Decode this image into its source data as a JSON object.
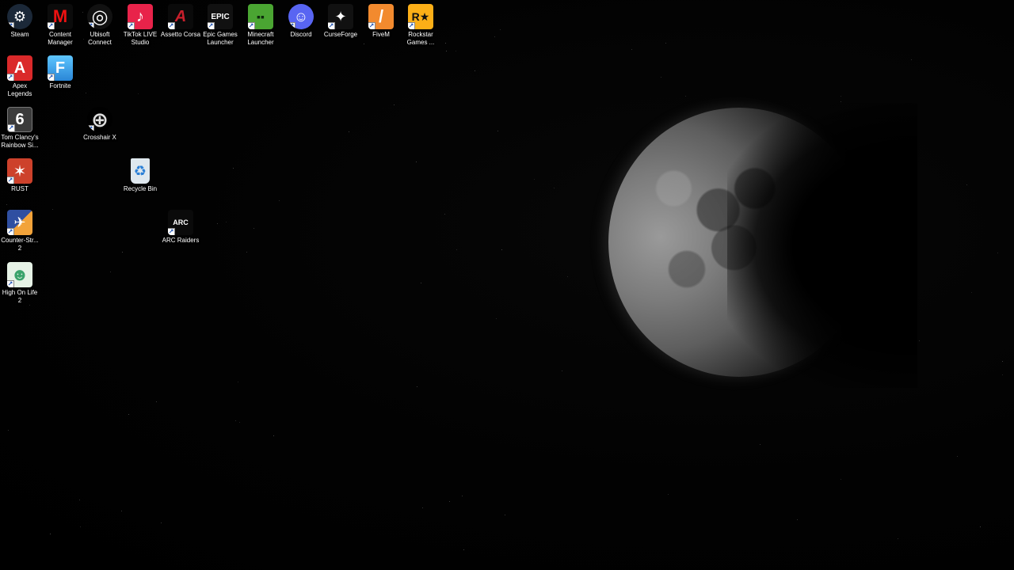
{
  "desktop": {
    "icons": [
      {
        "label": "Steam",
        "icon": "steam-icon",
        "color": "#1b2838",
        "glyph": "⚙"
      },
      {
        "label": "Content\nManager",
        "icon": "content-manager-icon",
        "color": "#0b0b0b",
        "glyph": "M"
      },
      {
        "label": "Ubisoft\nConnect",
        "icon": "ubisoft-icon",
        "color": "#111111",
        "glyph": "◎"
      },
      {
        "label": "TikTok LIVE\nStudio",
        "icon": "tiktok-live-icon",
        "color": "#e8234a",
        "glyph": "♪"
      },
      {
        "label": "Assetto Corsa",
        "icon": "assetto-corsa-icon",
        "color": "#0a0a0a",
        "glyph": "A"
      },
      {
        "label": "Epic Games\nLauncher",
        "icon": "epic-games-icon",
        "color": "#111111",
        "glyph": "EPIC"
      },
      {
        "label": "Minecraft\nLauncher",
        "icon": "minecraft-icon",
        "color": "#4aa532",
        "glyph": "▪▪"
      },
      {
        "label": "Discord",
        "icon": "discord-icon",
        "color": "#5865f2",
        "glyph": "☺"
      },
      {
        "label": "CurseForge",
        "icon": "curseforge-icon",
        "color": "#111111",
        "glyph": "✦"
      },
      {
        "label": "FiveM",
        "icon": "fivem-icon",
        "color": "#f28a2e",
        "glyph": "/"
      },
      {
        "label": "Rockstar\nGames ...",
        "icon": "rockstar-icon",
        "color": "#fcaf17",
        "glyph": "R★"
      },
      {
        "label": "Apex\nLegends",
        "icon": "apex-legends-icon",
        "color": "#da292a",
        "glyph": "A"
      },
      {
        "label": "Fortnite",
        "icon": "fortnite-icon",
        "color": "#3fa9f5",
        "glyph": "F"
      },
      {
        "label": "Tom Clancy's\nRainbow Si...",
        "icon": "rainbow-six-icon",
        "color": "#3b3b3b",
        "glyph": "6"
      },
      {
        "label": "Crosshair X",
        "icon": "crosshair-x-icon",
        "color": "#000000",
        "glyph": "⊕"
      },
      {
        "label": "RUST",
        "icon": "rust-icon",
        "color": "#cd412b",
        "glyph": "✶"
      },
      {
        "label": "Recycle Bin",
        "icon": "recycle-bin-icon",
        "color": "#dfe8ee",
        "glyph": "♻"
      },
      {
        "label": "Counter-Str...\n2",
        "icon": "counter-strike-icon",
        "color": "#2f4fa1",
        "glyph": "✈"
      },
      {
        "label": "ARC Raiders",
        "icon": "arc-raiders-icon",
        "color": "#0a0a0a",
        "glyph": "ARC"
      },
      {
        "label": "High On Life\n2",
        "icon": "high-on-life-icon",
        "color": "#e6f2e6",
        "glyph": "☻"
      }
    ]
  }
}
